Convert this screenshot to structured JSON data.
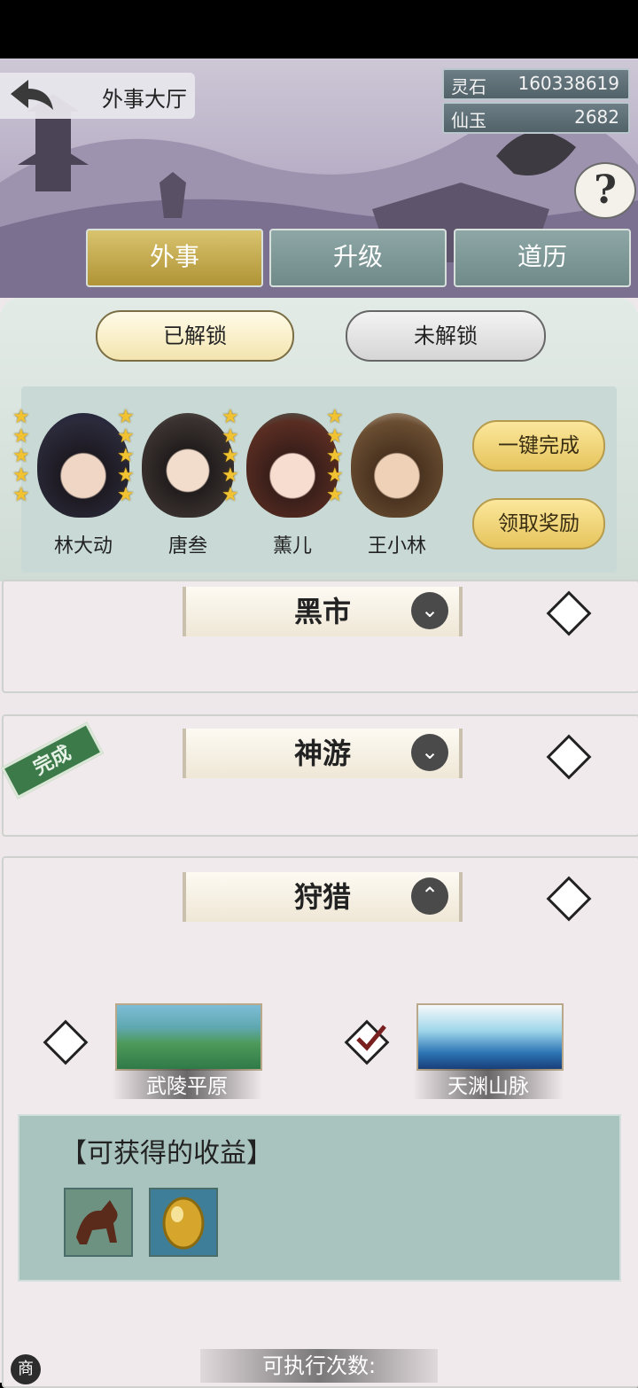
{
  "header": {
    "title": "外事大厅"
  },
  "currency": [
    {
      "label": "灵石",
      "value": "160338619"
    },
    {
      "label": "仙玉",
      "value": "2682"
    }
  ],
  "help_glyph": "?",
  "tabs": [
    {
      "label": "外事",
      "active": true
    },
    {
      "label": "升级",
      "active": false
    },
    {
      "label": "道历",
      "active": false
    }
  ],
  "filters": {
    "unlocked": "已解锁",
    "locked": "未解锁"
  },
  "heroes": [
    {
      "name": "林大动",
      "stars": 5
    },
    {
      "name": "唐叁",
      "stars": 5
    },
    {
      "name": "薰儿",
      "stars": 5
    },
    {
      "name": "王小林",
      "stars": 5
    }
  ],
  "actions": {
    "one_click": "一键完成",
    "claim": "领取奖励"
  },
  "sections": [
    {
      "title": "黑市",
      "chevron": "⌄",
      "stamp": ""
    },
    {
      "title": "神游",
      "chevron": "⌄",
      "stamp": "完成"
    },
    {
      "title": "狩猎",
      "chevron": "⌃",
      "stamp": ""
    }
  ],
  "locations": [
    {
      "name": "武陵平原",
      "selected": false
    },
    {
      "name": "天渊山脉",
      "selected": true
    }
  ],
  "rewards": {
    "title": "【可获得的收益】",
    "items": [
      "horse-beast-icon",
      "golden-egg-icon"
    ]
  },
  "exec_label": "可执行次数:",
  "shop_tag": "商"
}
